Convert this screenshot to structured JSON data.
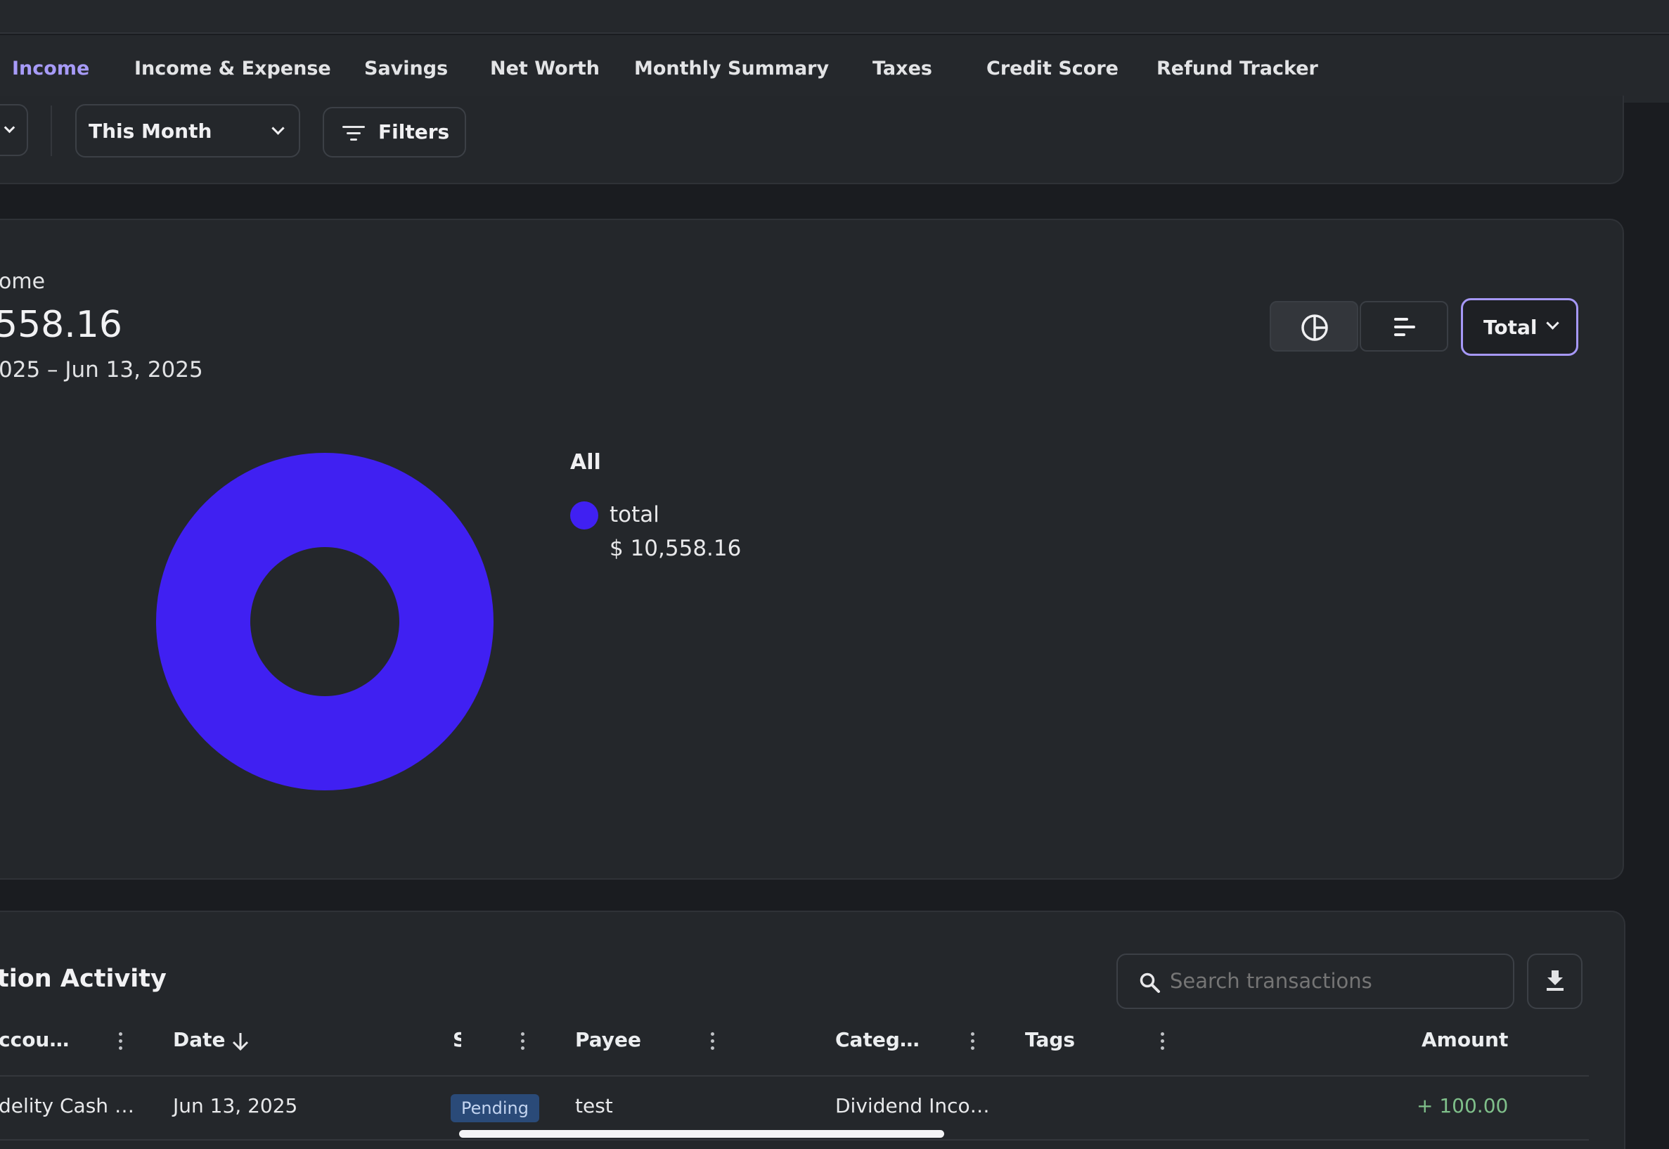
{
  "tabs": [
    "Income",
    "Income & Expense",
    "Savings",
    "Net Worth",
    "Monthly Summary",
    "Taxes",
    "Credit Score",
    "Refund Tracker"
  ],
  "filters": {
    "date_range": "This Month",
    "filters_label": "Filters"
  },
  "summary": {
    "title": "ome",
    "amount": "558.16",
    "range": "025 – Jun 13, 2025"
  },
  "chart_controls": {
    "group_by": "Total"
  },
  "chart_data": {
    "type": "pie",
    "legend_title": "All",
    "categories": [
      "total"
    ],
    "values": [
      10558.16
    ],
    "value_labels": [
      "$ 10,558.16"
    ],
    "colors": [
      "#4020f2"
    ],
    "donut": true,
    "legend_placement": "right"
  },
  "transactions": {
    "title": "tion Activity",
    "search_placeholder": "Search transactions",
    "columns": {
      "account": "ccou…",
      "date": "Date",
      "status": "S",
      "payee": "Payee",
      "category": "Categ…",
      "tags": "Tags",
      "amount": "Amount"
    },
    "rows": [
      {
        "account": "delity Cash …",
        "date": "Jun 13, 2025",
        "status": "Pending",
        "payee": "test",
        "category": "Dividend Inco…",
        "tags": "",
        "amount": "+ 100.00"
      }
    ]
  },
  "colors": {
    "accent": "#8d7ff2",
    "chart_primary": "#4020f2",
    "positive": "#7fbf8a",
    "pending_bg": "#2a4a78"
  }
}
